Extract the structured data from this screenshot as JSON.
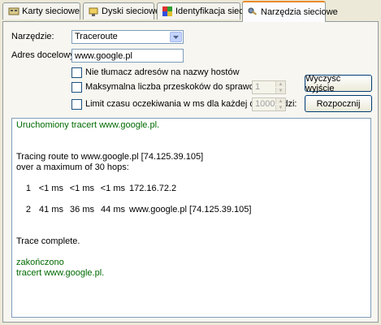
{
  "tabs": [
    {
      "label": "Karty sieciowe",
      "icon": "network-card-icon",
      "active": false
    },
    {
      "label": "Dyski sieciowe",
      "icon": "network-drive-icon",
      "active": false
    },
    {
      "label": "Identyfikacja sieci",
      "icon": "network-id-icon",
      "active": false
    },
    {
      "label": "Narzędzia sieciowe",
      "icon": "network-tools-icon",
      "active": true
    }
  ],
  "form": {
    "tool_label": "Narzędzie:",
    "tool_value": "Traceroute",
    "address_label": "Adres docelowy:",
    "address_value": "www.google.pl",
    "opt_no_resolve": "Nie tłumacz adresów na nazwy hostów",
    "opt_max_hops": "Maksymalna liczba przeskoków do sprawdzenia:",
    "opt_max_hops_value": "1",
    "opt_timeout": "Limit czasu oczekiwania w ms dla każdej odpowiedzi:",
    "opt_timeout_value": "1000",
    "clear_button": "Wyczyść wyjście",
    "start_button": "Rozpocznij"
  },
  "output": {
    "started": "Uruchomiony tracert www.google.pl.",
    "tracing": "Tracing route to www.google.pl [74.125.39.105]",
    "max_hops": "over a maximum of 30 hops:",
    "hops": [
      {
        "n": "1",
        "t1": "<1 ms",
        "t2": "<1 ms",
        "t3": "<1 ms",
        "host": "172.16.72.2"
      },
      {
        "n": "2",
        "t1": "41 ms",
        "t2": "36 ms",
        "t3": "44 ms",
        "host": "www.google.pl [74.125.39.105]"
      }
    ],
    "complete": "Trace complete.",
    "finished": "zakończono",
    "finished_cmd": "tracert www.google.pl."
  },
  "colors": {
    "active_tab_accent": "#e68b2c",
    "output_status_green": "#006a00"
  }
}
